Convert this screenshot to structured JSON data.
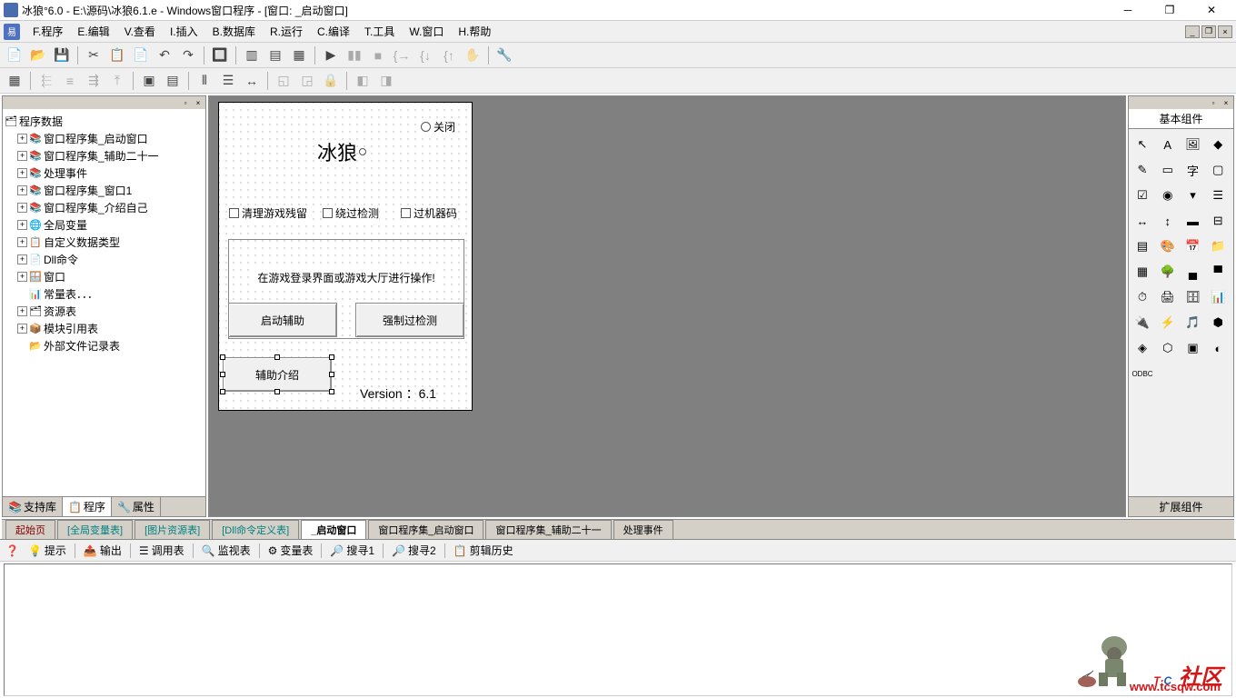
{
  "title": "冰狼°6.0 - E:\\源码\\冰狼6.1.e - Windows窗口程序 - [窗口: _启动窗口]",
  "menu": {
    "items": [
      "F.程序",
      "E.编辑",
      "V.查看",
      "I.插入",
      "B.数据库",
      "R.运行",
      "C.编译",
      "T.工具",
      "W.窗口",
      "H.帮助"
    ]
  },
  "tree": {
    "root": "程序数据",
    "items": [
      {
        "label": "窗口程序集_启动窗口",
        "icon": "📚",
        "expand": true
      },
      {
        "label": "窗口程序集_辅助二十一",
        "icon": "📚",
        "expand": true
      },
      {
        "label": "处理事件",
        "icon": "📚",
        "expand": true
      },
      {
        "label": "窗口程序集_窗口1",
        "icon": "📚",
        "expand": true
      },
      {
        "label": "窗口程序集_介绍自己",
        "icon": "📚",
        "expand": true
      },
      {
        "label": "全局变量",
        "icon": "🌐",
        "expand": true
      },
      {
        "label": "自定义数据类型",
        "icon": "📋",
        "expand": true
      },
      {
        "label": "Dll命令",
        "icon": "📄",
        "expand": true
      },
      {
        "label": "窗口",
        "icon": "🪟",
        "expand": true
      },
      {
        "label": "常量表．．．",
        "icon": "📊",
        "expand": false
      },
      {
        "label": "资源表",
        "icon": "🗂",
        "expand": true
      },
      {
        "label": "模块引用表",
        "icon": "📦",
        "expand": true
      },
      {
        "label": "外部文件记录表",
        "icon": "📂",
        "expand": false
      }
    ]
  },
  "left_tabs": [
    "支持库",
    "程序",
    "属性"
  ],
  "form": {
    "close_radio": "关闭",
    "title": "冰狼",
    "checks": [
      "清理游戏残留",
      "绕过检测",
      "过机器码"
    ],
    "hint": "在游戏登录界面或游戏大厅进行操作!",
    "btn1": "启动辅助",
    "btn2": "强制过检测",
    "btn3": "辅助介绍",
    "version": "Version ：6.1"
  },
  "right_panel": {
    "tab_basic": "基本组件",
    "tab_ext": "扩展组件"
  },
  "doc_tabs": [
    {
      "label": "起始页",
      "cls": "red"
    },
    {
      "label": "[全局变量表]",
      "cls": "colored"
    },
    {
      "label": "[图片资源表]",
      "cls": "colored"
    },
    {
      "label": "[Dll命令定义表]",
      "cls": "colored"
    },
    {
      "label": "_启动窗口",
      "cls": "active"
    },
    {
      "label": "窗口程序集_启动窗口",
      "cls": ""
    },
    {
      "label": "窗口程序集_辅助二十一",
      "cls": ""
    },
    {
      "label": "处理事件",
      "cls": ""
    }
  ],
  "bottom_tabs": [
    "提示",
    "输出",
    "调用表",
    "监视表",
    "变量表",
    "搜寻1",
    "搜寻2",
    "剪辑历史"
  ],
  "watermark": {
    "brand_t": "T",
    "brand_c": "C",
    "brand_rest": "社区",
    "url": "www.tcsqw.com"
  }
}
